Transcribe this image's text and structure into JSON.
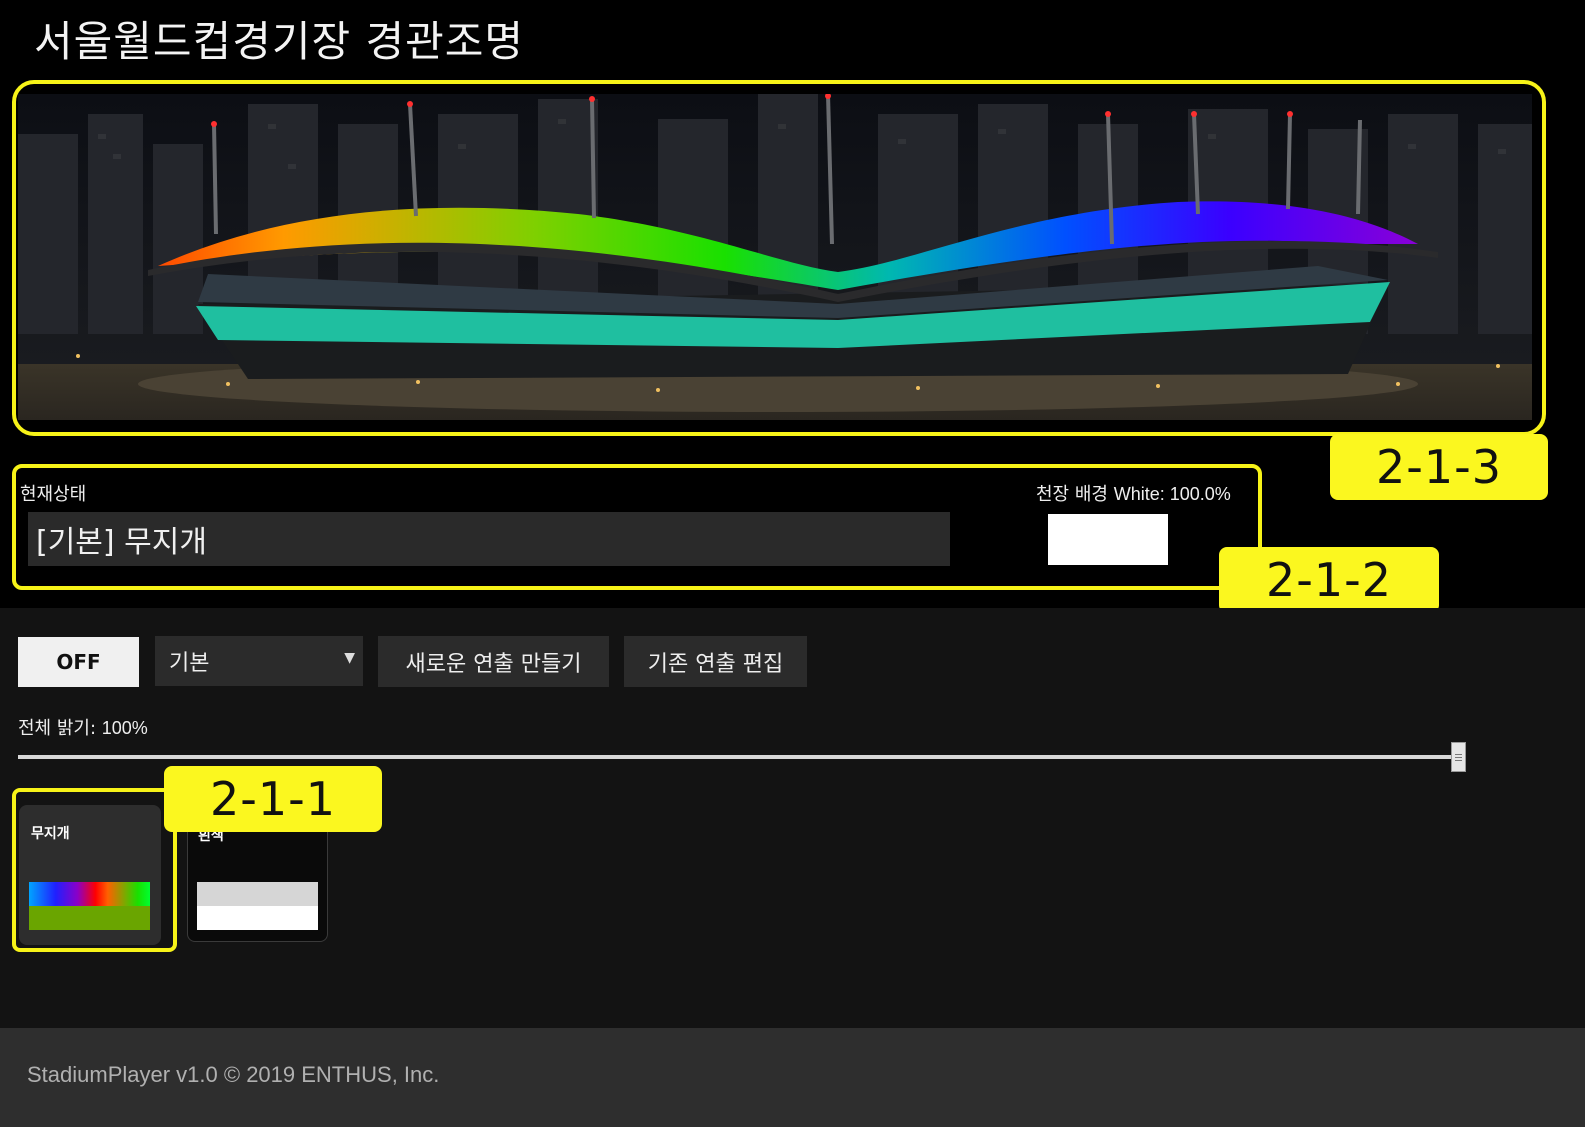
{
  "header": {
    "title": "서울월드컵경기장 경관조명"
  },
  "callouts": {
    "stage": "2-1-3",
    "status": "2-1-2",
    "cards": "2-1-1"
  },
  "status": {
    "label": "현재상태",
    "current": "[기본] 무지개",
    "ceiling_label": "천장 배경",
    "ceiling_value": "White: 100.0%",
    "ceiling_color": "#ffffff"
  },
  "toolbar": {
    "off_label": "OFF",
    "mode_selected": "기본",
    "new_label": "새로운 연출 만들기",
    "edit_label": "기존 연출 편집"
  },
  "brightness": {
    "label": "전체 밝기:",
    "value": "100%",
    "level": 1.0
  },
  "presets": [
    {
      "name": "무지개",
      "colors": [
        "#00a4ff",
        "#2020ff",
        "#ff0000",
        "#19e000",
        "#6aa500"
      ]
    },
    {
      "name": "흰색",
      "colors": [
        "#d6d6d6",
        "#ffffff"
      ]
    }
  ],
  "stage": {
    "roof_gradient": [
      "#ff4a00",
      "#ff9a00",
      "#7ed000",
      "#19e000",
      "#00b8b0",
      "#0050ff",
      "#3a00ff",
      "#8a00d8"
    ],
    "facade_color": "#1fbfa0"
  },
  "footer": {
    "copyright": "StadiumPlayer v1.0 © 2019 ENTHUS, Inc."
  }
}
